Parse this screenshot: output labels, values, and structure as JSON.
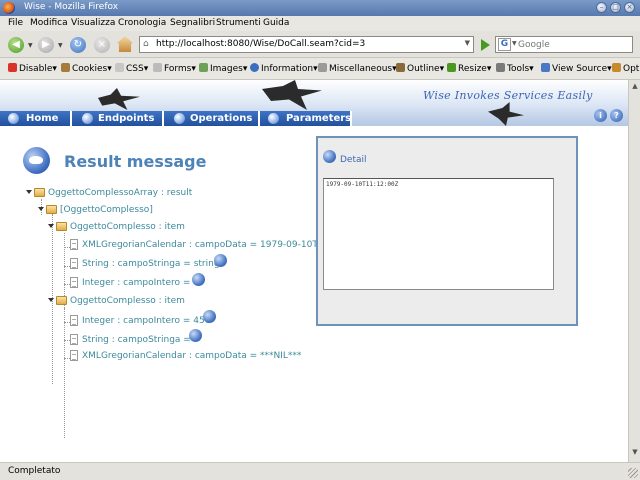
{
  "window": {
    "title": "Wise - Mozilla Firefox"
  },
  "menu": [
    "File",
    "Modifica",
    "Visualizza",
    "Cronologia",
    "Segnalibri",
    "Strumenti",
    "Guida"
  ],
  "nav": {
    "url": "http://localhost:8080/Wise/DoCall.seam?cid=3",
    "search_placeholder": "Google"
  },
  "devbar": [
    "Disable",
    "Cookies",
    "CSS",
    "Forms",
    "Images",
    "Information",
    "Miscellaneous",
    "Outline",
    "Resize",
    "Tools",
    "View Source",
    "Opt"
  ],
  "banner": {
    "tagline": "Wise Invokes Services Easily"
  },
  "tabs": [
    "Home",
    "Endpoints",
    "Operations",
    "Parameters"
  ],
  "result": {
    "title": "Result message",
    "tree": {
      "root": "OggettoComplessoArray : result",
      "array_node": "[OggettoComplesso]",
      "item1": "OggettoComplesso : item",
      "item1_a": "XMLGregorianCalendar : campoData = 1979-09-10T",
      "item1_b": "String : campoStringa = string",
      "item1_c": "Integer : campoIntero = 4",
      "item2": "OggettoComplesso : item",
      "item2_a": "Integer : campoIntero = 456",
      "item2_b": "String : campoStringa =",
      "item2_c": "XMLGregorianCalendar : campoData = ***NIL***"
    }
  },
  "detail": {
    "label": "Detail",
    "value": "1979-09-10T11:12:00Z"
  },
  "status": {
    "text": "Completato"
  },
  "icons": {
    "browser": "firefox-icon",
    "back": "back-arrow-icon",
    "forward": "forward-arrow-icon",
    "reload": "reload-icon",
    "stop": "stop-icon",
    "home": "home-icon",
    "go": "go-arrow-icon",
    "search_engine": "google-icon",
    "detail": "magnifier-icon",
    "result": "chat-bubble-icon"
  }
}
